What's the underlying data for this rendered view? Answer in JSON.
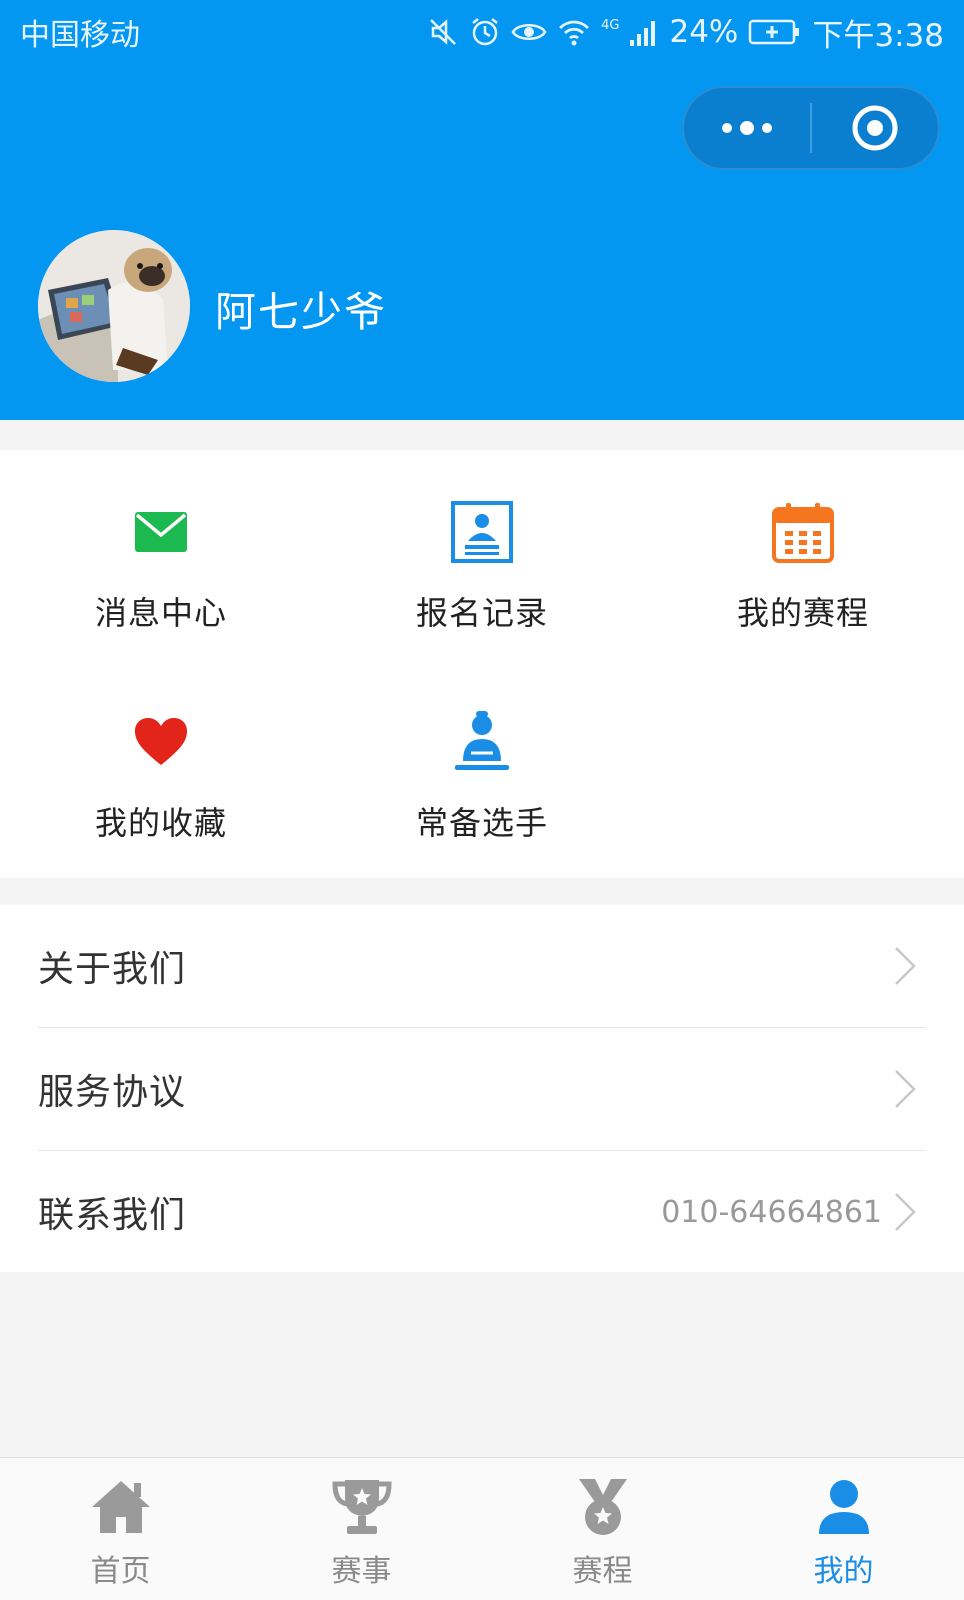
{
  "status_bar": {
    "carrier": "中国移动",
    "network": "4G",
    "battery": "24%",
    "time": "下午3:38"
  },
  "capsule": {
    "more_icon": "more-dots-icon",
    "close_icon": "target-close-icon"
  },
  "profile": {
    "username": "阿七少爷"
  },
  "grid": {
    "items": [
      {
        "label": "消息中心",
        "icon": "mail-icon",
        "color": "#1bb94f"
      },
      {
        "label": "报名记录",
        "icon": "contact-card-icon",
        "color": "#1a8ee6"
      },
      {
        "label": "我的赛程",
        "icon": "calendar-icon",
        "color": "#f5761f"
      },
      {
        "label": "我的收藏",
        "icon": "heart-icon",
        "color": "#e2241b"
      },
      {
        "label": "常备选手",
        "icon": "player-icon",
        "color": "#1a8ee6"
      }
    ]
  },
  "menu": {
    "items": [
      {
        "label": "关于我们",
        "value": ""
      },
      {
        "label": "服务协议",
        "value": ""
      },
      {
        "label": "联系我们",
        "value": "010-64664861"
      }
    ]
  },
  "tabbar": {
    "items": [
      {
        "label": "首页",
        "icon": "home-icon"
      },
      {
        "label": "赛事",
        "icon": "trophy-icon"
      },
      {
        "label": "赛程",
        "icon": "medal-icon"
      },
      {
        "label": "我的",
        "icon": "user-icon"
      }
    ],
    "active_color": "#1a8ee6",
    "inactive_color": "#8a8a8a"
  },
  "colors": {
    "header_bg": "#0397f2"
  }
}
